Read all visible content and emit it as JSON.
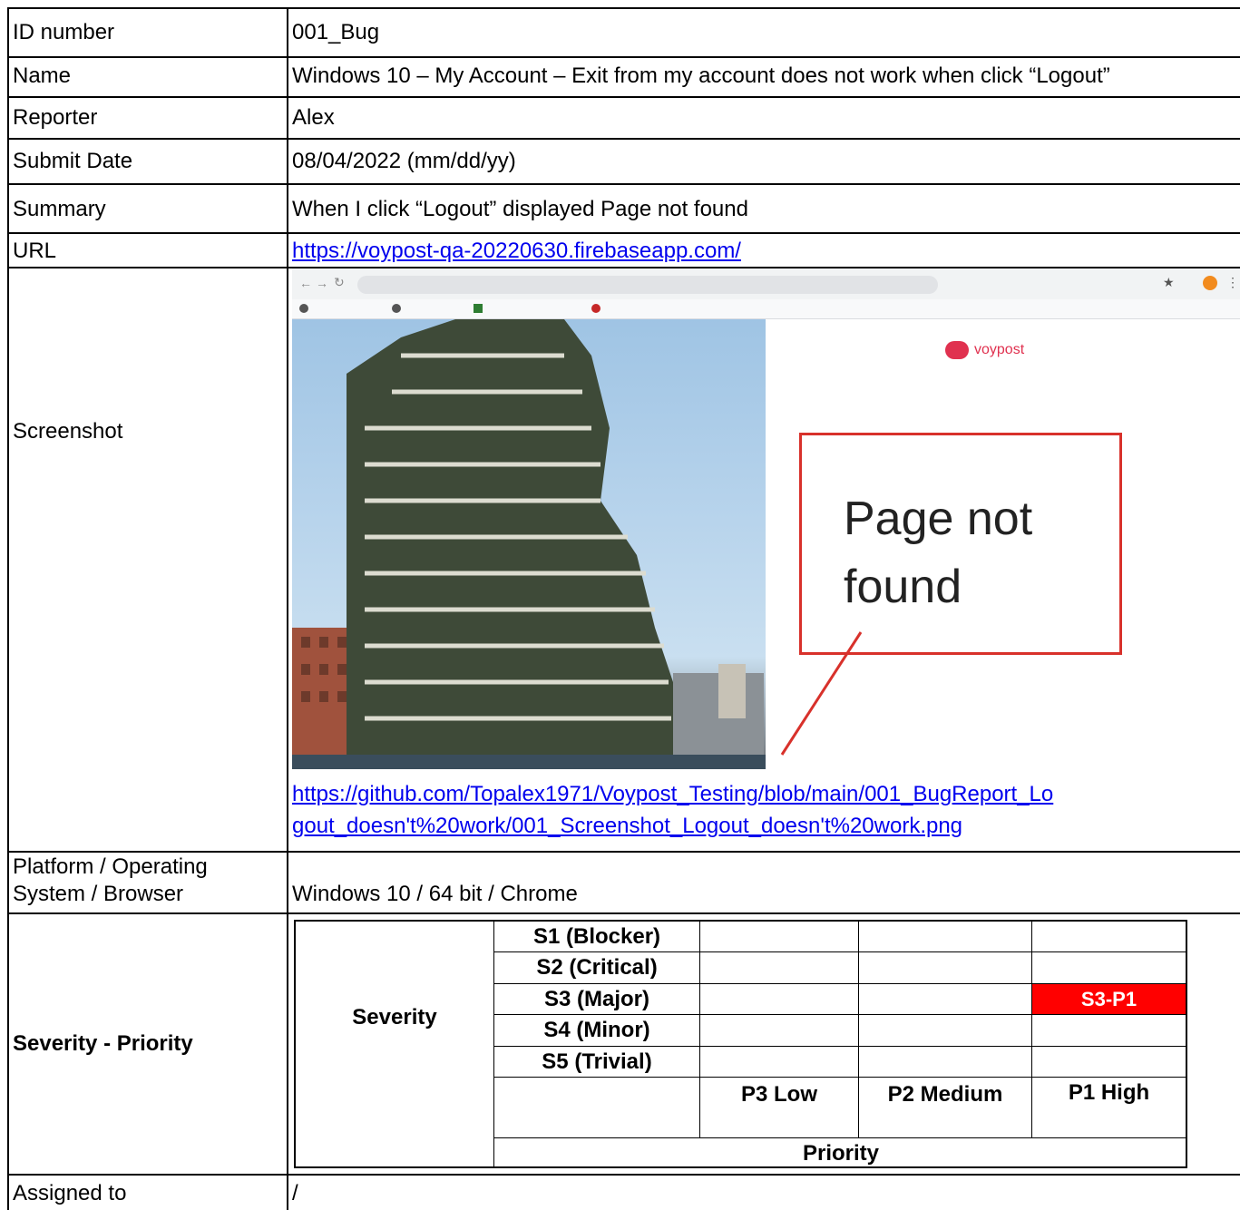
{
  "rows": {
    "id_label": "ID number",
    "id_value": "001_Bug",
    "name_label": "Name",
    "name_value": "Windows 10 – My Account – Exit from my account does not work when click “Logout”",
    "reporter_label": "Reporter",
    "reporter_value": "Alex",
    "date_label": "Submit Date",
    "date_value": "08/04/2022 (mm/dd/yy)",
    "summary_label": "Summary",
    "summary_value": "When I click “Logout” displayed Page not found",
    "url_label": "URL",
    "url_value": "https://voypost-qa-20220630.firebaseapp.com/",
    "screenshot_label": "Screenshot",
    "screenshot_link_1": "https://github.com/Topalex1971/Voypost_Testing/blob/main/001_BugReport_Lo",
    "screenshot_link_2": "gout_doesn't%20work/001_Screenshot_Logout_doesn't%20work.png",
    "platform_label_1": "Platform / Operating",
    "platform_label_2": "System / Browser",
    "platform_value": "Windows 10 / 64 bit / Chrome",
    "severity_priority_label": "Severity - Priority",
    "assigned_label": "Assigned to",
    "assigned_value": "/"
  },
  "matrix": {
    "severity_heading": "Severity",
    "priority_heading": "Priority",
    "severities": [
      "S1 (Blocker)",
      "S2 (Critical)",
      "S3 (Major)",
      "S4 (Minor)",
      "S5 (Trivial)"
    ],
    "priorities": [
      "P3 Low",
      "P2 Medium",
      "P1 High"
    ],
    "selected_label": "S3-P1",
    "selected_color": "#ff0000"
  },
  "screenshot": {
    "brand": "voypost",
    "message_1": "Page not",
    "message_2": "found",
    "annotation_color": "#d8312b"
  }
}
